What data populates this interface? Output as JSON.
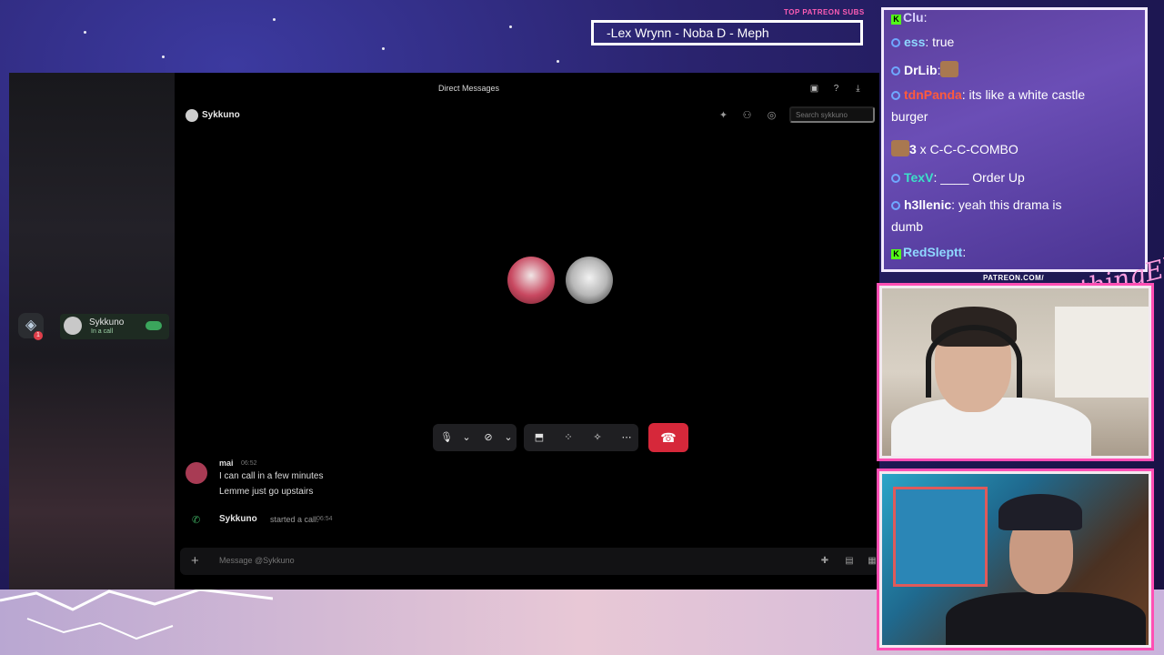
{
  "overlay": {
    "top_patreon_label": "TOP PATREON SUBS",
    "top_patreon_names": "-Lex Wrynn -  Noba D - Meph",
    "patreon_label": "PATREON.COM/",
    "patreon_brand": "AnythingElse"
  },
  "discord": {
    "topbar_title": "Direct Messages",
    "channel_name": "Sykkuno",
    "search_placeholder": "Search sykkuno",
    "call_pill": {
      "name": "Sykkuno",
      "status": "In a call",
      "server_badge": "1"
    },
    "messages": [
      {
        "author": "mai",
        "time": "06:52",
        "lines": [
          "I can call in a few minutes",
          "Lemme just go upstairs"
        ]
      }
    ],
    "system_message": {
      "name": "Sykkuno",
      "text": "started a call.",
      "time": "06:54"
    },
    "composer_placeholder": "Message @Sykkuno",
    "colors": {
      "hangup": "#d6283a",
      "call_green": "#3ba55c"
    }
  },
  "chat": {
    "lines": [
      {
        "name": "Clu",
        "text": ":"
      },
      {
        "name": "ess",
        "text": ": true"
      },
      {
        "name": "DrLib",
        "text": ":"
      },
      {
        "name": "tdnPanda",
        "text": ": its like a white castle"
      },
      {
        "name": "",
        "text": "burger"
      },
      {
        "name": "3",
        "text": " x C-C-C-COMBO"
      },
      {
        "name": "TexV",
        "text": ":    ____ Order Up"
      },
      {
        "name": "h3llenic",
        "text": ": yeah this drama is"
      },
      {
        "name": "",
        "text": "dumb"
      },
      {
        "name": "RedSleptt",
        "text": ":"
      }
    ],
    "colors": {
      "tdnPanda": "#ff5a3c",
      "TexV": "#3ce0c8",
      "ess": "#8fd8ff",
      "RedSleptt": "#8fd8ff"
    }
  }
}
